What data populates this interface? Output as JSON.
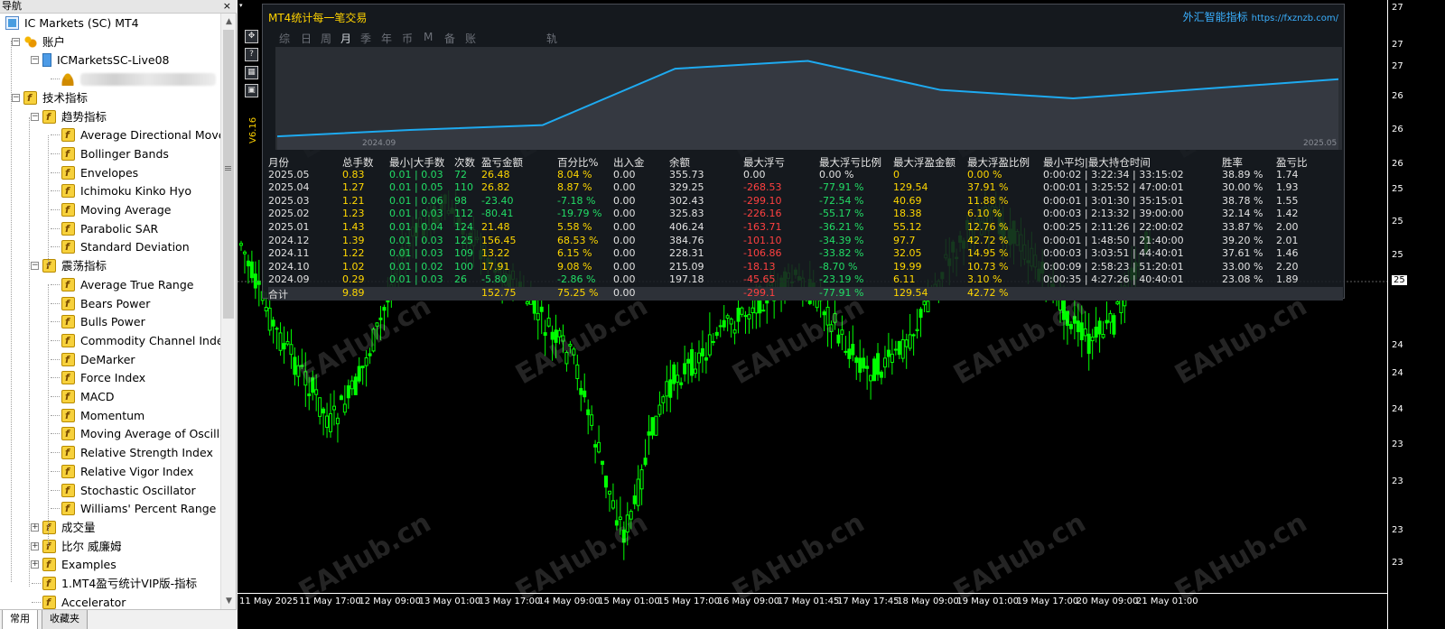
{
  "navigator": {
    "title": "导航",
    "close_glyph": "×",
    "tree": [
      {
        "label": "IC Markets (SC) MT4",
        "icon": "mt4-icon",
        "level": 0,
        "expander": ""
      },
      {
        "label": "账户",
        "icon": "accounts-icon",
        "level": 1,
        "expander": "−"
      },
      {
        "label": "ICMarketsSC-Live08",
        "icon": "account-icon",
        "level": 2,
        "expander": "−"
      },
      {
        "label": "",
        "icon": "user-icon",
        "level": 3,
        "expander": "",
        "blurred": true
      },
      {
        "label": "技术指标",
        "icon": "indicator-icon",
        "level": 1,
        "expander": "−"
      },
      {
        "label": "趋势指标",
        "icon": "indicator-icon",
        "level": 2,
        "expander": "−"
      },
      {
        "label": "Average Directional Movement Index",
        "icon": "indicator-icon",
        "level": 3,
        "expander": ""
      },
      {
        "label": "Bollinger Bands",
        "icon": "indicator-icon",
        "level": 3,
        "expander": ""
      },
      {
        "label": "Envelopes",
        "icon": "indicator-icon",
        "level": 3,
        "expander": ""
      },
      {
        "label": "Ichimoku Kinko Hyo",
        "icon": "indicator-icon",
        "level": 3,
        "expander": ""
      },
      {
        "label": "Moving Average",
        "icon": "indicator-icon",
        "level": 3,
        "expander": ""
      },
      {
        "label": "Parabolic SAR",
        "icon": "indicator-icon",
        "level": 3,
        "expander": ""
      },
      {
        "label": "Standard Deviation",
        "icon": "indicator-icon",
        "level": 3,
        "expander": ""
      },
      {
        "label": "震荡指标",
        "icon": "indicator-icon",
        "level": 2,
        "expander": "−"
      },
      {
        "label": "Average True Range",
        "icon": "indicator-icon",
        "level": 3,
        "expander": ""
      },
      {
        "label": "Bears Power",
        "icon": "indicator-icon",
        "level": 3,
        "expander": ""
      },
      {
        "label": "Bulls Power",
        "icon": "indicator-icon",
        "level": 3,
        "expander": ""
      },
      {
        "label": "Commodity Channel Index",
        "icon": "indicator-icon",
        "level": 3,
        "expander": ""
      },
      {
        "label": "DeMarker",
        "icon": "indicator-icon",
        "level": 3,
        "expander": ""
      },
      {
        "label": "Force Index",
        "icon": "indicator-icon",
        "level": 3,
        "expander": ""
      },
      {
        "label": "MACD",
        "icon": "indicator-icon",
        "level": 3,
        "expander": ""
      },
      {
        "label": "Momentum",
        "icon": "indicator-icon",
        "level": 3,
        "expander": ""
      },
      {
        "label": "Moving Average of Oscillator",
        "icon": "indicator-icon",
        "level": 3,
        "expander": ""
      },
      {
        "label": "Relative Strength Index",
        "icon": "indicator-icon",
        "level": 3,
        "expander": ""
      },
      {
        "label": "Relative Vigor Index",
        "icon": "indicator-icon",
        "level": 3,
        "expander": ""
      },
      {
        "label": "Stochastic Oscillator",
        "icon": "indicator-icon",
        "level": 3,
        "expander": ""
      },
      {
        "label": "Williams' Percent Range",
        "icon": "indicator-icon",
        "level": 3,
        "expander": ""
      },
      {
        "label": "成交量",
        "icon": "indicator-icon",
        "level": 2,
        "expander": "+"
      },
      {
        "label": "比尔 威廉姆",
        "icon": "indicator-icon",
        "level": 2,
        "expander": "+"
      },
      {
        "label": "Examples",
        "icon": "indicator-icon",
        "level": 2,
        "expander": "+"
      },
      {
        "label": "1.MT4盈亏统计VIP版-指标",
        "icon": "indicator-icon",
        "level": 2,
        "expander": ""
      },
      {
        "label": "Accelerator",
        "icon": "indicator-icon",
        "level": 2,
        "expander": ""
      }
    ],
    "tabs": [
      "常用",
      "收藏夹"
    ]
  },
  "chart": {
    "price_labels": [
      "27",
      "27",
      "27",
      "26",
      "26",
      "26",
      "25",
      "25",
      "25",
      "24",
      "24",
      "24",
      "23",
      "23",
      "23",
      "23"
    ],
    "current_price_label": "25",
    "time_labels": [
      "11 May 2025",
      "11 May 17:00",
      "12 May 09:00",
      "13 May 01:00",
      "13 May 17:00",
      "14 May 09:00",
      "15 May 01:00",
      "15 May 17:00",
      "16 May 09:00",
      "17 May 01:45",
      "17 May 17:45",
      "18 May 09:00",
      "19 May 01:00",
      "19 May 17:00",
      "20 May 09:00",
      "21 May 01:00"
    ],
    "watermark": "EAHub.cn",
    "colors": {
      "background": "#000000",
      "candles": "#00ff00",
      "line": "#1eaaf0"
    }
  },
  "panel": {
    "title": "MT4统计每一笔交易",
    "brand": "外汇智能指标",
    "brand_url": "https://fxznzb.com/",
    "version": "V6.16",
    "tabs": [
      "综",
      "日",
      "周",
      "月",
      "季",
      "年",
      "币",
      "M",
      "备",
      "账户",
      "轨迹"
    ],
    "active_tab": "月",
    "side_tools": [
      "move-icon",
      "help-icon",
      "calculator-icon",
      "screenshot-icon"
    ],
    "mini_chart": {
      "x_start": "2024.09",
      "x_end": "2025.05",
      "balance_series": [
        197.18,
        215.09,
        228.31,
        384.76,
        406.24,
        325.83,
        302.43,
        329.25,
        355.73
      ]
    },
    "table": {
      "headers": [
        "月份",
        "总手数",
        "最小|大手数",
        "次数",
        "盈亏金额",
        "百分比%",
        "出入金",
        "余额",
        "最大浮亏",
        "最大浮亏比例",
        "最大浮盈金额",
        "最大浮盈比例",
        "最小平均|最大持仓时间",
        "胜率",
        "盈亏比"
      ],
      "rows": [
        [
          "2025.05",
          "0.83",
          "0.01 | 0.03",
          "72",
          "26.48",
          "8.04 %",
          "0.00",
          "355.73",
          "0.00",
          "0.00 %",
          "0",
          "0.00 %",
          "0:00:02 | 3:22:34 | 33:15:02",
          "38.89 %",
          "1.74"
        ],
        [
          "2025.04",
          "1.27",
          "0.01 | 0.05",
          "110",
          "26.82",
          "8.87 %",
          "0.00",
          "329.25",
          "-268.53",
          "-77.91 %",
          "129.54",
          "37.91 %",
          "0:00:01 | 3:25:52 | 47:00:01",
          "30.00 %",
          "1.93"
        ],
        [
          "2025.03",
          "1.21",
          "0.01 | 0.06",
          "98",
          "-23.40",
          "-7.18 %",
          "0.00",
          "302.43",
          "-299.10",
          "-72.54 %",
          "40.69",
          "11.88 %",
          "0:00:01 | 3:01:30 | 35:15:01",
          "38.78 %",
          "1.55"
        ],
        [
          "2025.02",
          "1.23",
          "0.01 | 0.03",
          "112",
          "-80.41",
          "-19.79 %",
          "0.00",
          "325.83",
          "-226.16",
          "-55.17 %",
          "18.38",
          "6.10 %",
          "0:00:03 | 2:13:32 | 39:00:00",
          "32.14 %",
          "1.42"
        ],
        [
          "2025.01",
          "1.43",
          "0.01 | 0.04",
          "124",
          "21.48",
          "5.58 %",
          "0.00",
          "406.24",
          "-163.71",
          "-36.21 %",
          "55.12",
          "12.76 %",
          "0:00:25 | 2:11:26 | 22:00:02",
          "33.87 %",
          "2.00"
        ],
        [
          "2024.12",
          "1.39",
          "0.01 | 0.03",
          "125",
          "156.45",
          "68.53 %",
          "0.00",
          "384.76",
          "-101.10",
          "-34.39 %",
          "97.7",
          "42.72 %",
          "0:00:01 | 1:48:50 | 21:40:00",
          "39.20 %",
          "2.01"
        ],
        [
          "2024.11",
          "1.22",
          "0.01 | 0.03",
          "109",
          "13.22",
          "6.15 %",
          "0.00",
          "228.31",
          "-106.86",
          "-33.82 %",
          "32.05",
          "14.95 %",
          "0:00:03 | 3:03:51 | 44:40:01",
          "37.61 %",
          "1.46"
        ],
        [
          "2024.10",
          "1.02",
          "0.01 | 0.02",
          "100",
          "17.91",
          "9.08 %",
          "0.00",
          "215.09",
          "-18.13",
          "-8.70 %",
          "19.99",
          "10.73 %",
          "0:00:09 | 2:58:23 | 51:20:01",
          "33.00 %",
          "2.20"
        ],
        [
          "2024.09",
          "0.29",
          "0.01 | 0.03",
          "26",
          "-5.80",
          "-2.86 %",
          "0.00",
          "197.18",
          "-45.65",
          "-23.19 %",
          "6.11",
          "3.10 %",
          "0:00:35 | 4:27:26 | 40:40:01",
          "23.08 %",
          "1.89"
        ]
      ],
      "total": [
        "合计",
        "9.89",
        "",
        "",
        "152.75",
        "75.25 %",
        "0.00",
        "",
        "-299.1",
        "-77.91 %",
        "129.54",
        "42.72 %",
        "",
        "",
        ""
      ]
    }
  }
}
